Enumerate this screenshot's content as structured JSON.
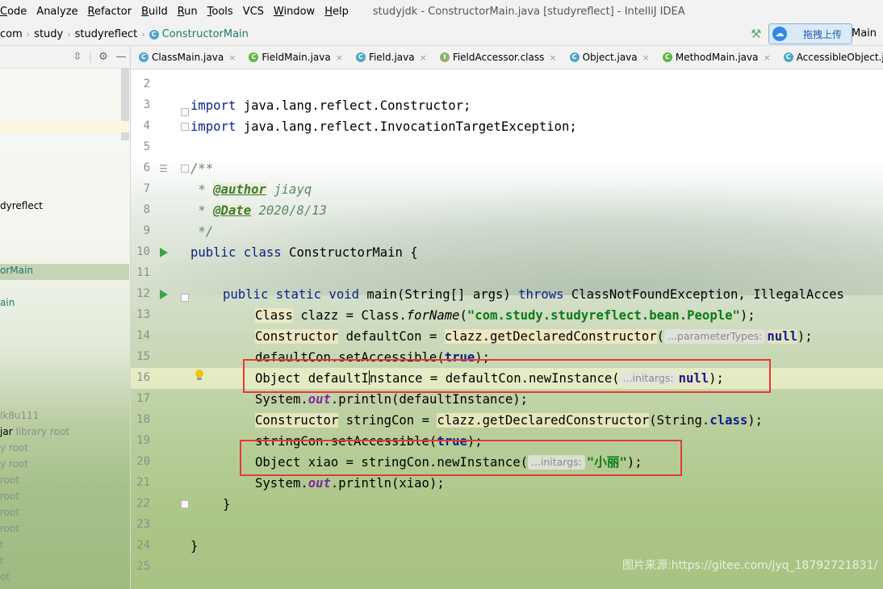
{
  "menubar": {
    "items": [
      {
        "u": "C",
        "rest": "ode"
      },
      {
        "u": "",
        "rest": "Analyze"
      },
      {
        "u": "R",
        "rest": "efactor"
      },
      {
        "u": "B",
        "rest": "uild"
      },
      {
        "u": "R",
        "rest": "un"
      },
      {
        "u": "T",
        "rest": "ools"
      },
      {
        "u": "",
        "rest": "VCS"
      },
      {
        "u": "W",
        "rest": "indow"
      },
      {
        "u": "H",
        "rest": "elp"
      }
    ],
    "window_title": "studyjdk - ConstructorMain.java [studyreflect] - IntelliJ IDEA"
  },
  "breadcrumb": [
    "com",
    "study",
    "studyreflect",
    "ConstructorMain"
  ],
  "upload_button": "拖拽上传",
  "run_config": "Main",
  "project_tree": [
    {
      "text": "dyreflect",
      "style": ""
    },
    {
      "text": "orMain",
      "style": "teal"
    },
    {
      "text": "ain",
      "style": "teal"
    },
    {
      "text": "lk8u111",
      "style": "gray"
    },
    {
      "text": "jar",
      "suffix": "library root",
      "style": ""
    },
    {
      "text": "y root",
      "style": "gray"
    },
    {
      "text": "y root",
      "style": "gray"
    },
    {
      "text": "root",
      "style": "gray"
    },
    {
      "text": "root",
      "style": "gray"
    },
    {
      "text": "root",
      "style": "gray"
    },
    {
      "text": "root",
      "style": "gray"
    },
    {
      "text": "t",
      "style": "gray"
    },
    {
      "text": "t",
      "style": "gray"
    },
    {
      "text": "ot",
      "style": "gray"
    }
  ],
  "tabs": [
    {
      "label": "ClassMain.java",
      "icon": "C",
      "type": "class"
    },
    {
      "label": "FieldMain.java",
      "icon": "C",
      "type": "green"
    },
    {
      "label": "Field.java",
      "icon": "C",
      "type": "class"
    },
    {
      "label": "FieldAccessor.class",
      "icon": "I",
      "type": "iface"
    },
    {
      "label": "Object.java",
      "icon": "C",
      "type": "class"
    },
    {
      "label": "MethodMain.java",
      "icon": "C",
      "type": "green"
    },
    {
      "label": "AccessibleObject.java",
      "icon": "C",
      "type": "class"
    }
  ],
  "line_numbers": [
    "2",
    "3",
    "4",
    "5",
    "6",
    "7",
    "8",
    "9",
    "10",
    "11",
    "12",
    "13",
    "14",
    "15",
    "16",
    "17",
    "18",
    "19",
    "20",
    "21",
    "22",
    "23",
    "24",
    "25"
  ],
  "code": {
    "l3_kw": "import",
    "l3_rest": " java.lang.reflect.Constructor;",
    "l4_kw": "import",
    "l4_rest": " java.lang.reflect.InvocationTargetException;",
    "l6": "/**",
    "l7_pre": " * ",
    "l7_tag": "@author",
    "l7_val": " jiayq",
    "l8_pre": " * ",
    "l8_tag": "@Date",
    "l8_val": " 2020/8/13",
    "l9": " */",
    "l10_kw": "public class",
    "l10_rest": " ConstructorMain {",
    "l12_kw": "public static void",
    "l12_mid": " main(String[] args) ",
    "l12_throws": "throws",
    "l12_rest": " ClassNotFoundException, IllegalAcces",
    "l13_a": "Class",
    "l13_b": " clazz = Class.",
    "l13_c": "forName",
    "l13_d": "(",
    "l13_str": "\"com.study.studyreflect.bean.People\"",
    "l13_e": ");",
    "l14_a": "Constructor",
    "l14_b": " defaultCon = ",
    "l14_c": "clazz.getDeclaredConstructor",
    "l14_d": "(",
    "l14_hint": "...parameterTypes:",
    "l14_null": "null",
    "l14_e": ");",
    "l15_a": "defaultCon.setAccessible(",
    "l15_kw": "true",
    "l15_b": ");",
    "l16_a": "Object defaultI",
    "l16_b": "nstance = defaultCon.newInstance(",
    "l16_hint": "...initargs:",
    "l16_null": "null",
    "l16_e": ");",
    "l17_a": "System.",
    "l17_out": "out",
    "l17_b": ".println(defaultInstance);",
    "l18_a": "Constructor",
    "l18_b": " stringCon = ",
    "l18_c": "clazz.getDeclaredConstructor",
    "l18_d": "(String.",
    "l18_kw": "class",
    "l18_e": ");",
    "l19_a": "stringCon.setAccessible(",
    "l19_kw": "true",
    "l19_b": ");",
    "l20_a": "Object xiao = stringCon.newInstance(",
    "l20_hint": "...initargs:",
    "l20_str": "\"小丽\"",
    "l20_e": ");",
    "l21_a": "System.",
    "l21_out": "out",
    "l21_b": ".println(xiao);",
    "l22": "}",
    "l24": "}"
  },
  "watermark": "图片来源:https://gitee.com/jyq_18792721831/"
}
